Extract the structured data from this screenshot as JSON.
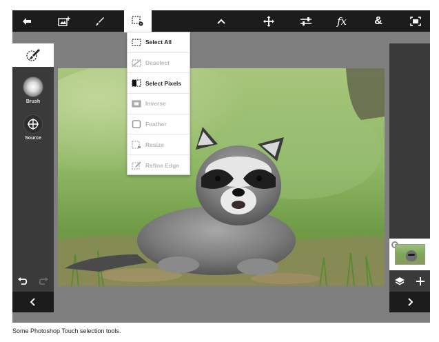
{
  "toolbar": {
    "items": [
      {
        "icon": "back-arrow-icon"
      },
      {
        "icon": "add-image-icon"
      },
      {
        "icon": "brush-icon"
      },
      {
        "icon": "selection-tools-icon",
        "active": true
      },
      {
        "icon": "chevron-up-icon"
      },
      {
        "icon": "move-icon"
      },
      {
        "icon": "adjustments-icon"
      },
      {
        "icon": "effects-icon",
        "label": "fx"
      },
      {
        "icon": "combine-icon",
        "label": "&"
      },
      {
        "icon": "fullscreen-icon"
      }
    ]
  },
  "selection_menu": {
    "items": [
      {
        "label": "Select All",
        "enabled": true,
        "icon": "marquee-icon"
      },
      {
        "label": "Deselect",
        "enabled": false,
        "icon": "deselect-icon"
      },
      {
        "label": "Select Pixels",
        "enabled": true,
        "icon": "select-pixels-icon"
      },
      {
        "label": "Inverse",
        "enabled": false,
        "icon": "inverse-icon"
      },
      {
        "label": "Feather",
        "enabled": false,
        "icon": "feather-icon"
      },
      {
        "label": "Resize",
        "enabled": false,
        "icon": "resize-icon"
      },
      {
        "label": "Refine Edge",
        "enabled": false,
        "icon": "refine-edge-icon"
      }
    ]
  },
  "left_panel": {
    "tab_icon": "selection-brush-icon",
    "tools": [
      {
        "label": "Brush",
        "icon": "brush-size-icon"
      },
      {
        "label": "Source",
        "icon": "crosshair-icon"
      }
    ],
    "undo_icon": "undo-icon",
    "redo_icon": "redo-icon",
    "nav_icon": "chevron-left-icon"
  },
  "right_panel": {
    "layer_icon": "layers-icon",
    "add_icon": "plus-icon",
    "nav_icon": "chevron-right-icon"
  },
  "canvas": {
    "subject": "raccoon-photo"
  },
  "caption": "Some Photoshop Touch selection tools.",
  "colors": {
    "toolbar_bg": "#1c1c1c",
    "panel_bg": "#3a3a3a",
    "workspace_bg": "#7f7f7f",
    "menu_bg": "#ffffff",
    "disabled_text": "#b8b8b8"
  }
}
